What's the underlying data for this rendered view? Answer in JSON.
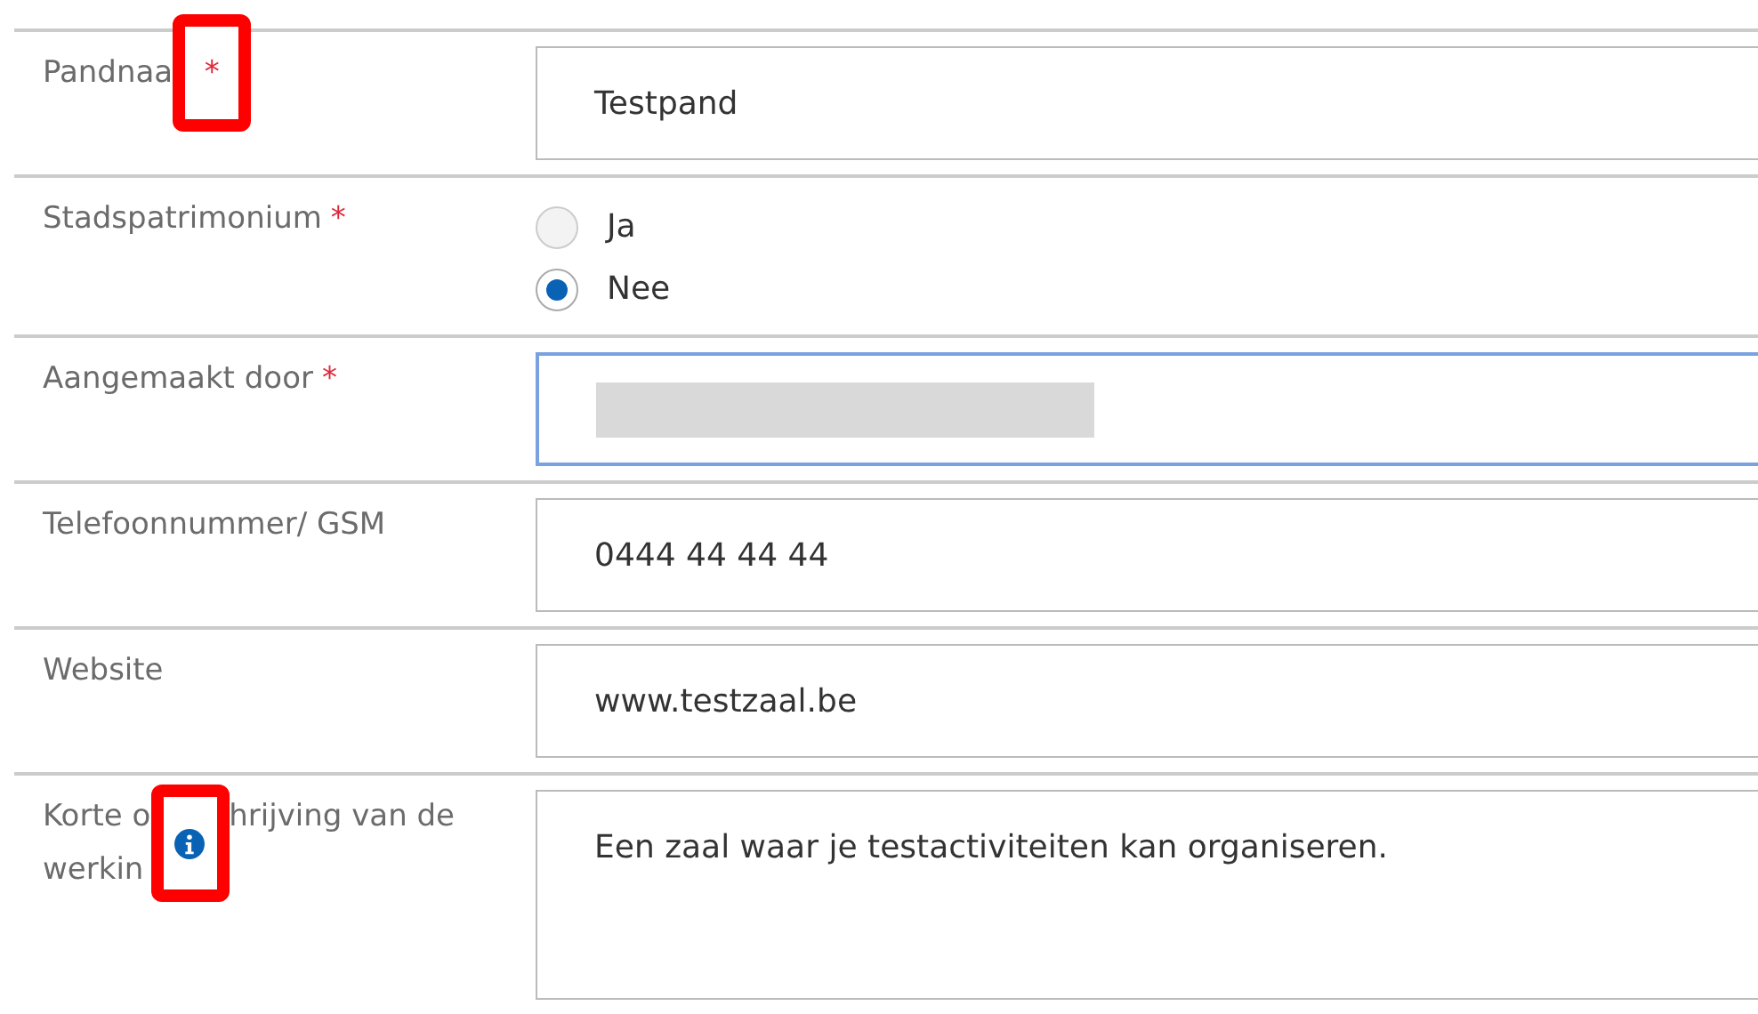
{
  "fields": [
    {
      "kind": "text",
      "label_lines": [
        [
          "Pandnaa"
        ]
      ],
      "required_mark": "*",
      "annotated": true,
      "value": "Testpand"
    },
    {
      "kind": "radio",
      "label_lines": [
        [
          "Stadspatrimonium"
        ]
      ],
      "required_mark": "*",
      "options": [
        {
          "label": "Ja",
          "selected": false,
          "disabled": true
        },
        {
          "label": "Nee",
          "selected": true,
          "disabled": false
        }
      ]
    },
    {
      "kind": "text",
      "label_lines": [
        [
          "Aangemaakt door"
        ]
      ],
      "required_mark": "*",
      "redacted": true,
      "focused": true
    },
    {
      "kind": "text",
      "label_lines": [
        [
          "Telefoonnummer/ GSM"
        ]
      ],
      "value": "0444 44 44 44"
    },
    {
      "kind": "text",
      "label_lines": [
        [
          "Website"
        ]
      ],
      "value": "www.testzaal.be"
    },
    {
      "kind": "textarea",
      "label_lines": [
        [
          "Korte o",
          "hrijving van de"
        ],
        [
          "werkin"
        ]
      ],
      "info_icon": true,
      "annotated": true,
      "value": "Een zaal waar je testactiviteiten kan organiseren."
    }
  ]
}
